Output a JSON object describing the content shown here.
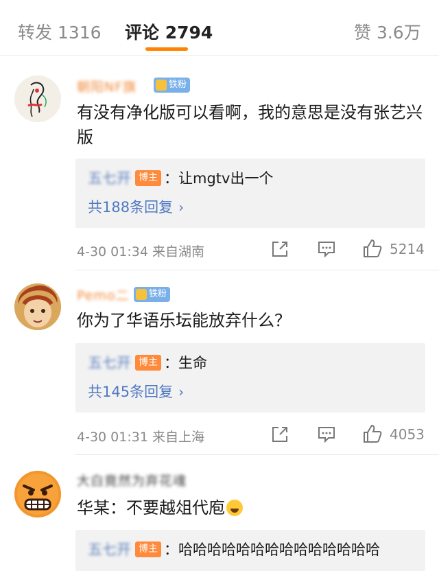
{
  "tabs": [
    {
      "label": "转发 1316"
    },
    {
      "label": "评论 2794"
    },
    {
      "label": "赞 3.6万"
    }
  ],
  "colors": {
    "accent": "#ff8200",
    "link": "#4f78c1",
    "host_badge": "#ff8a3c",
    "fan_badge": "#7ab0ea"
  },
  "comments": [
    {
      "username": "朝阳NF旗",
      "fan_badge": "铁粉",
      "text": "有没有净化版可以看啊，我的意思是没有张艺兴版",
      "reply": {
        "user": "五七开",
        "badge": "博主",
        "text": "：让mgtv出一个"
      },
      "reply_count": "共188条回复",
      "time": "4-30 01:34",
      "location": "来自湖南",
      "likes": "5214"
    },
    {
      "username": "Pemo二",
      "fan_badge": "铁粉",
      "text": "你为了华语乐坛能放弃什么？",
      "reply": {
        "user": "五七开",
        "badge": "博主",
        "text": "：生命"
      },
      "reply_count": "共145条回复",
      "time": "4-30 01:31",
      "location": "来自上海",
      "likes": "4053"
    },
    {
      "username": "大白竟然为弃花魂",
      "text": "华某：不要越俎代庖",
      "reply": {
        "user": "五七开",
        "badge": "博主",
        "text": "：哈哈哈哈哈哈哈哈哈哈哈哈哈哈"
      }
    }
  ],
  "icons": {
    "share": "share-icon",
    "comment": "comment-icon",
    "like": "thumbs-up-icon"
  }
}
